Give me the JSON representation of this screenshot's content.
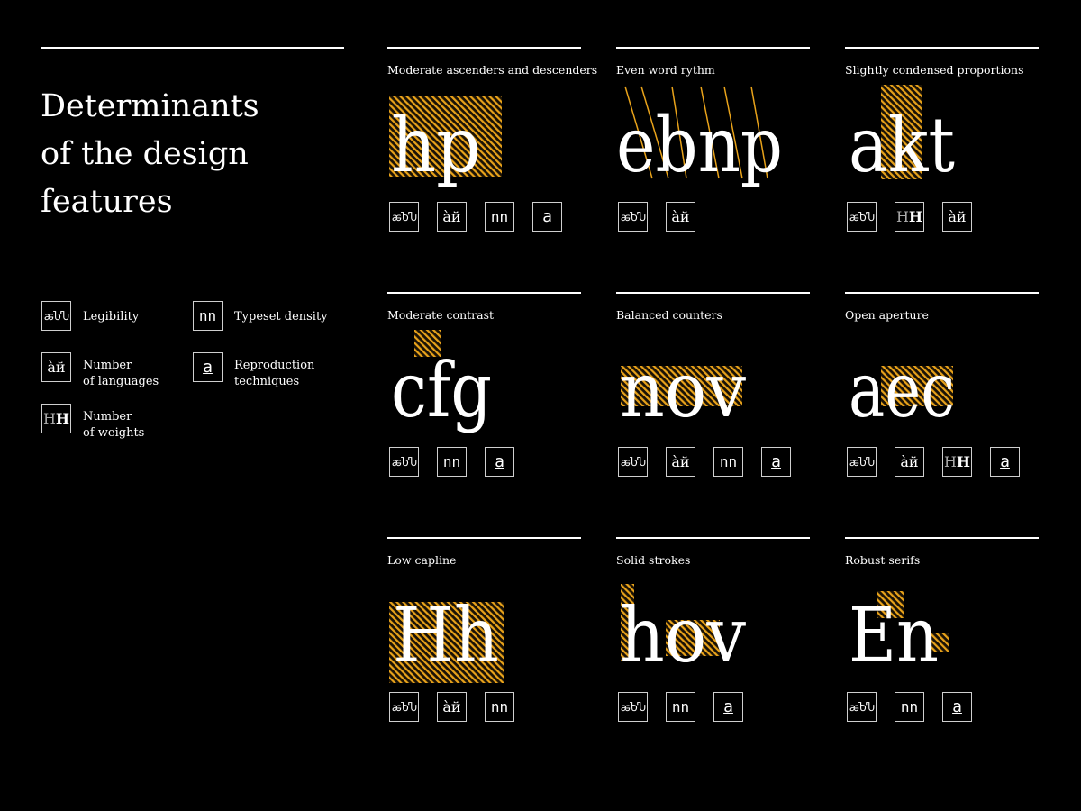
{
  "intro": {
    "line1": "Determinants",
    "line2": "of the design",
    "line3": "features"
  },
  "legend": [
    {
      "id": "legibility",
      "glyph": "ꬱႦჀ",
      "label1": "Legibility",
      "label2": ""
    },
    {
      "id": "density",
      "glyph": "nn",
      "label1": "Typeset density",
      "label2": ""
    },
    {
      "id": "languages",
      "glyph": "àй",
      "label1": "Number",
      "label2": "of languages"
    },
    {
      "id": "reproduction",
      "glyph": "a",
      "label1": "Reproduction",
      "label2": "techniques"
    },
    {
      "id": "weights",
      "glyph": "HH",
      "label1": "Number",
      "label2": "of weights"
    }
  ],
  "icon_glyphs": {
    "legibility": "ꬱႦჀ",
    "languages": "àй",
    "density": "nn",
    "reproduction": "a",
    "weights_light": "H",
    "weights_bold": "H"
  },
  "cells": [
    {
      "caption": "Moderate ascenders and descenders",
      "specimen": "hp",
      "icons": [
        "legibility",
        "languages",
        "density",
        "reproduction"
      ]
    },
    {
      "caption": "Even word rythm",
      "specimen": "ebnp",
      "icons": [
        "legibility",
        "languages"
      ]
    },
    {
      "caption": "Slightly condensed proportions",
      "specimen": "akt",
      "icons": [
        "legibility",
        "weights",
        "languages"
      ]
    },
    {
      "caption": "Moderate contrast",
      "specimen": "cfg",
      "icons": [
        "legibility",
        "density",
        "reproduction"
      ]
    },
    {
      "caption": "Balanced counters",
      "specimen": "nov",
      "icons": [
        "legibility",
        "languages",
        "density",
        "reproduction"
      ]
    },
    {
      "caption": "Open aperture",
      "specimen": "aec",
      "icons": [
        "legibility",
        "languages",
        "weights",
        "reproduction"
      ]
    },
    {
      "caption": "Low capline",
      "specimen": "Hh",
      "icons": [
        "legibility",
        "languages",
        "density"
      ]
    },
    {
      "caption": "Solid strokes",
      "specimen": "hov",
      "icons": [
        "legibility",
        "density",
        "reproduction"
      ]
    },
    {
      "caption": "Robust serifs",
      "specimen": "En",
      "icons": [
        "legibility",
        "density",
        "reproduction"
      ]
    }
  ],
  "colors": {
    "background": "#000000",
    "foreground": "#ffffff",
    "accent": "#e8a21a",
    "icon_border": "#cfcfcf"
  }
}
